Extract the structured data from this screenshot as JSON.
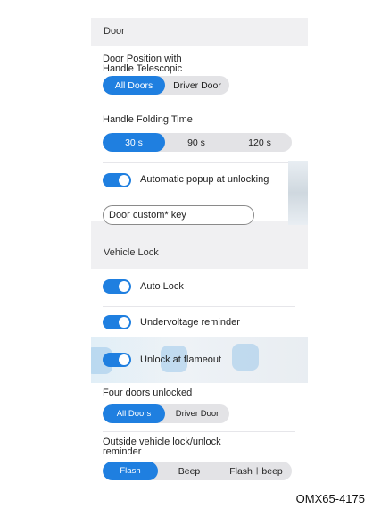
{
  "door": {
    "section_title": "Door",
    "position_label_line1": "Door Position with",
    "position_label_line2": "Handle Telescopic",
    "position_options": [
      "All Doors",
      "Driver Door"
    ],
    "position_selected": "All Doors",
    "folding_label": "Handle Folding Time",
    "folding_options": [
      "30 s",
      "90 s",
      "120 s"
    ],
    "folding_selected": "30 s",
    "auto_popup_label": "Automatic popup at unlocking",
    "auto_popup_on": true,
    "custom_key_label": "Door custom* key"
  },
  "vehicle_lock": {
    "section_title": "Vehicle Lock",
    "auto_lock_label": "Auto Lock",
    "auto_lock_on": true,
    "undervoltage_label": "Undervoltage reminder",
    "undervoltage_on": true,
    "unlock_flameout_label": "Unlock at flameout",
    "unlock_flameout_on": true,
    "four_doors_label": "Four doors unlocked",
    "four_doors_options": [
      "All Doors",
      "Driver Door"
    ],
    "four_doors_selected": "All Doors",
    "outside_label_line1": "Outside vehicle lock/unlock",
    "outside_label_line2": "reminder",
    "outside_options": [
      "Flash",
      "Beep",
      "Flash＋beep"
    ],
    "outside_selected": "Flash"
  },
  "colors": {
    "accent": "#1f7fe0",
    "panel_bg": "#f0f0f2",
    "card_bg": "#ffffff"
  },
  "figure_caption": "OMX65-4175"
}
